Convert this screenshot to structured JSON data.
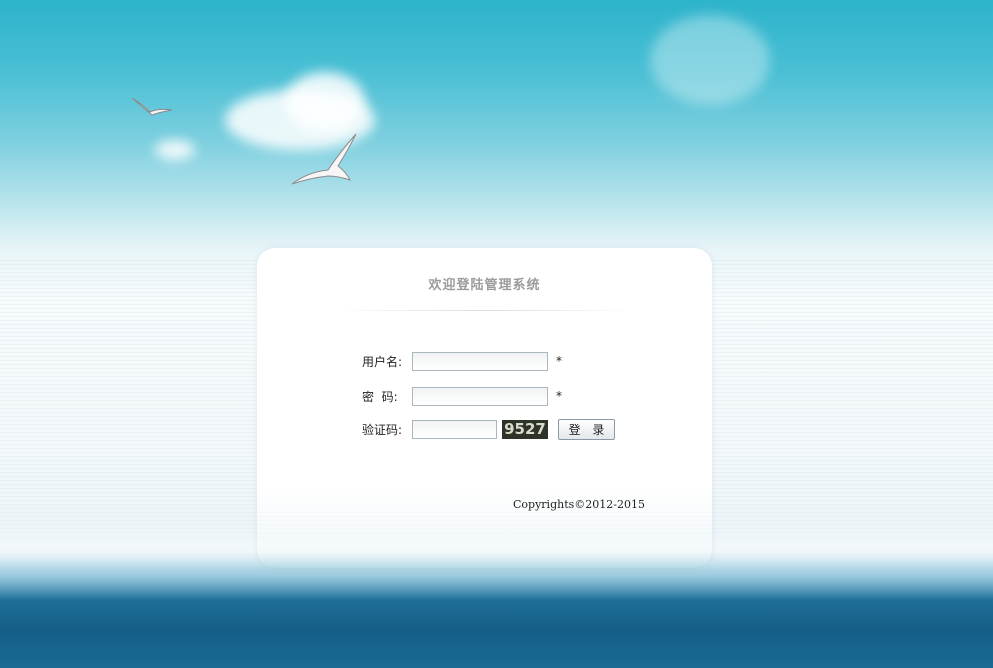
{
  "login": {
    "title": "欢迎登陆管理系统",
    "username": {
      "label": "用户名:",
      "value": "",
      "required_mark": "*"
    },
    "password": {
      "label": "密  码:",
      "value": "",
      "required_mark": "*"
    },
    "captcha": {
      "label": "验证码:",
      "value": "",
      "code": "9527"
    },
    "submit_label": "登 录",
    "copyright": "Copyrights©2012-2015"
  },
  "colors": {
    "sky": "#2db3cc",
    "sea": "#145e88",
    "panel": "#ffffff",
    "title_text": "#9b9b9b",
    "captcha_bg": "#2d3328"
  },
  "icons": [
    "seagull-icon",
    "cloud-icon"
  ]
}
